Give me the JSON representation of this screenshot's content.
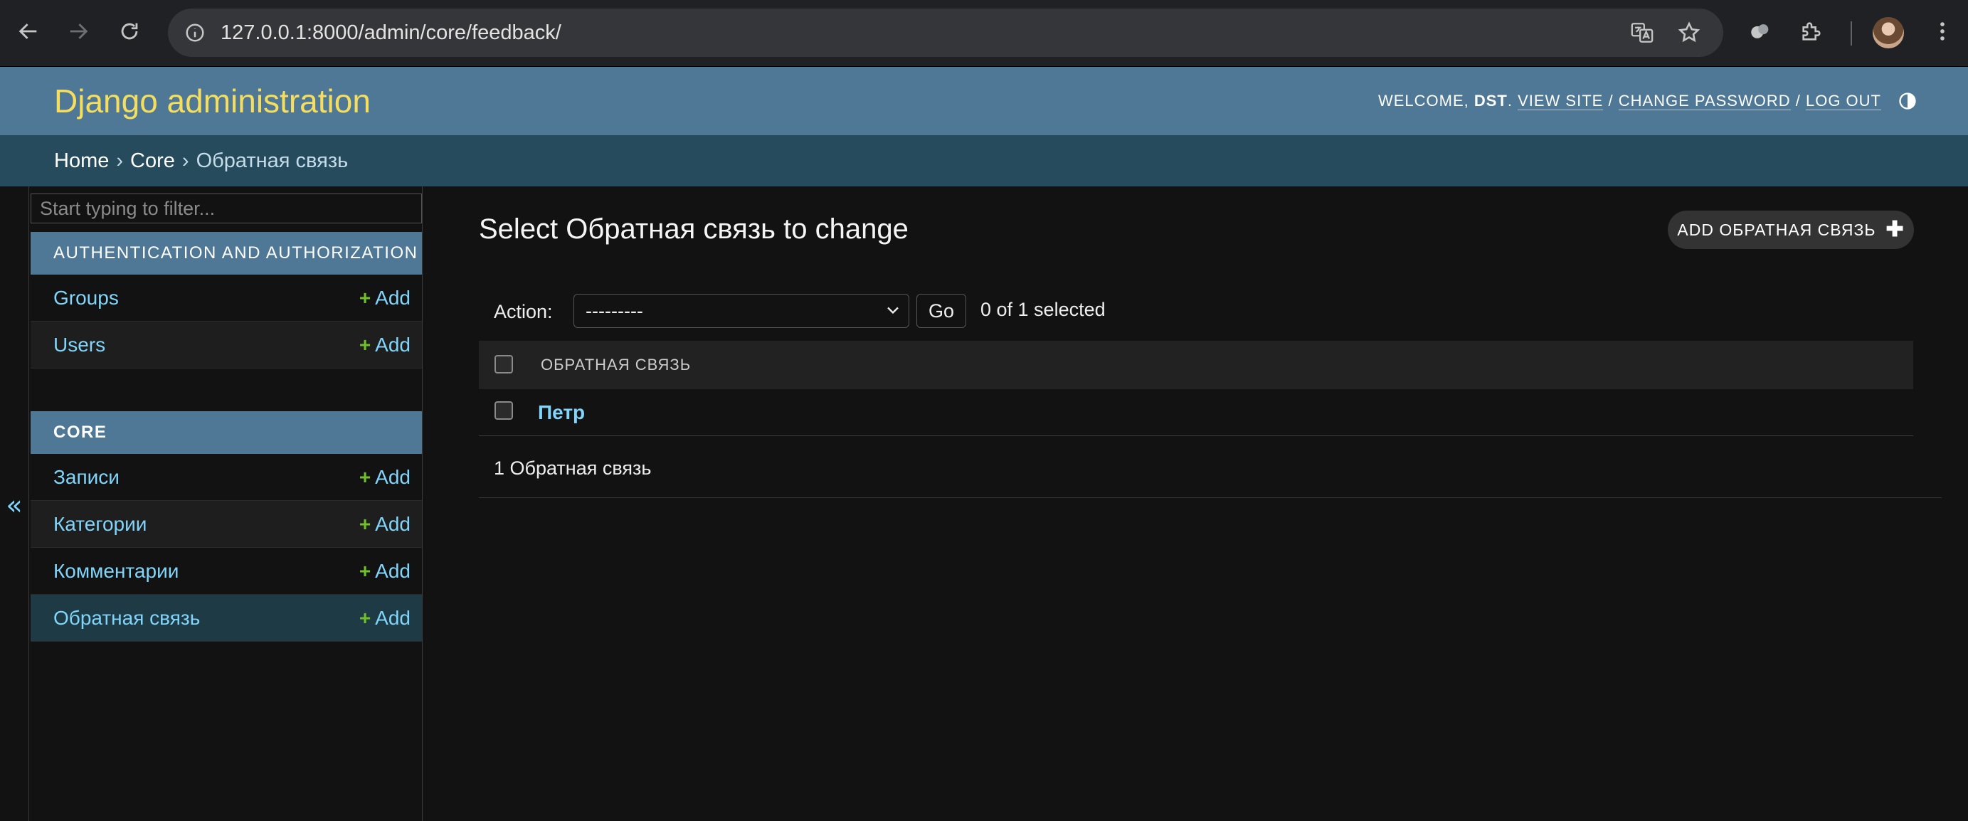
{
  "browser": {
    "url": "127.0.0.1:8000/admin/core/feedback/"
  },
  "header": {
    "branding": "Django administration",
    "welcome": "WELCOME,",
    "username": "DST",
    "view_site": "VIEW SITE",
    "change_password": "CHANGE PASSWORD",
    "log_out": "LOG OUT"
  },
  "breadcrumbs": {
    "home": "Home",
    "app": "Core",
    "current": "Обратная связь"
  },
  "sidebar": {
    "filter_placeholder": "Start typing to filter...",
    "add_label": "Add",
    "modules": [
      {
        "caption": "Authentication and Authorization",
        "models": [
          {
            "name": "Groups"
          },
          {
            "name": "Users"
          }
        ]
      },
      {
        "caption": "Core",
        "models": [
          {
            "name": "Записи"
          },
          {
            "name": "Категории"
          },
          {
            "name": "Комментарии"
          },
          {
            "name": "Обратная связь",
            "current": true
          }
        ]
      }
    ],
    "toggle_glyph": "«"
  },
  "main": {
    "title": "Select Обратная связь to change",
    "add_button": "ADD ОБРАТНАЯ СВЯЗЬ",
    "actions": {
      "label": "Action:",
      "selected_option": "---------",
      "go_label": "Go",
      "selection_count": "0 of 1 selected"
    },
    "table": {
      "column_header": "ОБРАТНАЯ СВЯЗЬ",
      "rows": [
        {
          "value": "Петр"
        }
      ]
    },
    "paginator": "1 Обратная связь"
  },
  "colors": {
    "header_bg": "#4e7896",
    "breadcrumbs_bg": "#264b5d",
    "branding": "#f5dd5d",
    "link": "#81d4fa",
    "add_plus": "#70bf2b",
    "page_bg": "#121212"
  }
}
